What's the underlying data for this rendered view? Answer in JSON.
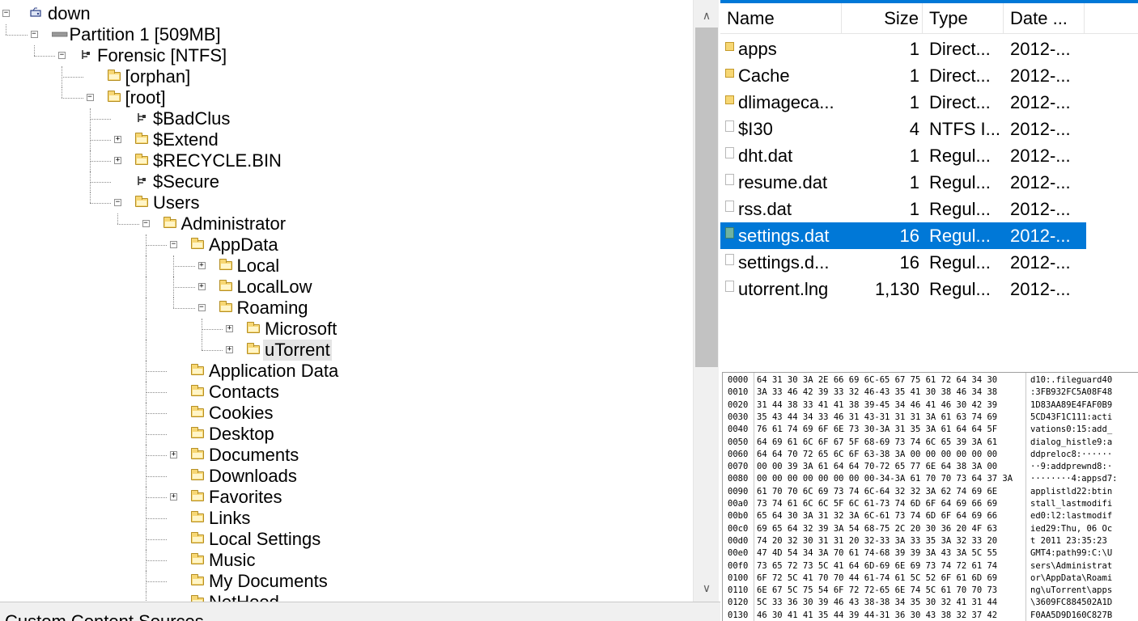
{
  "tree": {
    "rows": [
      {
        "label": "down",
        "icon": "drive-icon"
      },
      {
        "label": "Partition 1 [509MB]",
        "icon": "partition-icon"
      },
      {
        "label": "Forensic [NTFS]",
        "icon": "filesystem-icon"
      },
      {
        "label": "[orphan]",
        "icon": "folder-icon"
      },
      {
        "label": "[root]",
        "icon": "folder-icon"
      },
      {
        "label": "$BadClus",
        "icon": "system-file-icon"
      },
      {
        "label": "$Extend",
        "icon": "folder-icon"
      },
      {
        "label": "$RECYCLE.BIN",
        "icon": "folder-icon"
      },
      {
        "label": "$Secure",
        "icon": "system-file-icon"
      },
      {
        "label": "Users",
        "icon": "folder-icon"
      },
      {
        "label": "Administrator",
        "icon": "folder-icon"
      },
      {
        "label": "AppData",
        "icon": "folder-icon"
      },
      {
        "label": "Local",
        "icon": "folder-icon"
      },
      {
        "label": "LocalLow",
        "icon": "folder-icon"
      },
      {
        "label": "Roaming",
        "icon": "folder-icon"
      },
      {
        "label": "Microsoft",
        "icon": "folder-icon"
      },
      {
        "label": "uTorrent",
        "icon": "folder-icon"
      },
      {
        "label": "Application Data",
        "icon": "folder-icon"
      },
      {
        "label": "Contacts",
        "icon": "folder-icon"
      },
      {
        "label": "Cookies",
        "icon": "folder-icon"
      },
      {
        "label": "Desktop",
        "icon": "folder-icon"
      },
      {
        "label": "Documents",
        "icon": "folder-icon"
      },
      {
        "label": "Downloads",
        "icon": "folder-icon"
      },
      {
        "label": "Favorites",
        "icon": "folder-icon"
      },
      {
        "label": "Links",
        "icon": "folder-icon"
      },
      {
        "label": "Local Settings",
        "icon": "folder-icon"
      },
      {
        "label": "Music",
        "icon": "folder-icon"
      },
      {
        "label": "My Documents",
        "icon": "folder-icon"
      },
      {
        "label": "NetHood",
        "icon": "folder-icon"
      }
    ]
  },
  "scrollbar": {
    "up_icon": "up-arrow-icon",
    "down_icon": "down-arrow-icon"
  },
  "status_bar": {
    "text": "Custom Content Sources"
  },
  "file_list": {
    "columns": {
      "name": "Name",
      "size": "Size",
      "type": "Type",
      "date": "Date ..."
    },
    "rows": [
      {
        "name": "apps",
        "size": "1",
        "type": "Direct...",
        "date": "2012-...",
        "icon": "folder-icon"
      },
      {
        "name": "Cache",
        "size": "1",
        "type": "Direct...",
        "date": "2012-...",
        "icon": "folder-icon"
      },
      {
        "name": "dlimageca...",
        "size": "1",
        "type": "Direct...",
        "date": "2012-...",
        "icon": "folder-icon"
      },
      {
        "name": "$I30",
        "size": "4",
        "type": "NTFS I...",
        "date": "2012-...",
        "icon": "file-icon"
      },
      {
        "name": "dht.dat",
        "size": "1",
        "type": "Regul...",
        "date": "2012-...",
        "icon": "file-icon"
      },
      {
        "name": "resume.dat",
        "size": "1",
        "type": "Regul...",
        "date": "2012-...",
        "icon": "file-icon"
      },
      {
        "name": "rss.dat",
        "size": "1",
        "type": "Regul...",
        "date": "2012-...",
        "icon": "file-icon"
      },
      {
        "name": "settings.dat",
        "size": "16",
        "type": "Regul...",
        "date": "2012-...",
        "icon": "file-icon",
        "selected": true
      },
      {
        "name": "settings.d...",
        "size": "16",
        "type": "Regul...",
        "date": "2012-...",
        "icon": "file-icon"
      },
      {
        "name": "utorrent.lng",
        "size": "1,130",
        "type": "Regul...",
        "date": "2012-...",
        "icon": "file-icon"
      }
    ]
  },
  "hex": {
    "rows": [
      {
        "offset": "0000",
        "bytes": "64 31 30 3A 2E 66 69 6C-65 67 75 61 72 64 34 30",
        "ascii": "d10:.fileguard40"
      },
      {
        "offset": "0010",
        "bytes": "3A 33 46 42 39 33 32 46-43 35 41 30 38 46 34 38",
        "ascii": ":3FB932FC5A08F48"
      },
      {
        "offset": "0020",
        "bytes": "31 44 38 33 41 41 38 39-45 34 46 41 46 30 42 39",
        "ascii": "1D83AA89E4FAF0B9"
      },
      {
        "offset": "0030",
        "bytes": "35 43 44 34 33 46 31 43-31 31 31 3A 61 63 74 69",
        "ascii": "5CD43F1C111:acti"
      },
      {
        "offset": "0040",
        "bytes": "76 61 74 69 6F 6E 73 30-3A 31 35 3A 61 64 64 5F",
        "ascii": "vations0:15:add_"
      },
      {
        "offset": "0050",
        "bytes": "64 69 61 6C 6F 67 5F 68-69 73 74 6C 65 39 3A 61",
        "ascii": "dialog_histle9:a"
      },
      {
        "offset": "0060",
        "bytes": "64 64 70 72 65 6C 6F 63-38 3A 00 00 00 00 00 00",
        "ascii": "ddpreloc8:······"
      },
      {
        "offset": "0070",
        "bytes": "00 00 39 3A 61 64 64 70-72 65 77 6E 64 38 3A 00",
        "ascii": "··9:addprewnd8:·"
      },
      {
        "offset": "0080",
        "bytes": "00 00 00 00 00 00 00 00-34-3A 61 70 70 73 64 37 3A",
        "ascii": "········4:appsd7:"
      },
      {
        "offset": "0090",
        "bytes": "61 70 70 6C 69 73 74 6C-64 32 32 3A 62 74 69 6E",
        "ascii": "applistld22:btin"
      },
      {
        "offset": "00a0",
        "bytes": "73 74 61 6C 6C 5F 6C 61-73 74 6D 6F 64 69 66 69",
        "ascii": "stall_lastmodifi"
      },
      {
        "offset": "00b0",
        "bytes": "65 64 30 3A 31 32 3A 6C-61 73 74 6D 6F 64 69 66",
        "ascii": "ed0:l2:lastmodif"
      },
      {
        "offset": "00c0",
        "bytes": "69 65 64 32 39 3A 54 68-75 2C 20 30 36 20 4F 63",
        "ascii": "ied29:Thu, 06 Oc"
      },
      {
        "offset": "00d0",
        "bytes": "74 20 32 30 31 31 20 32-33 3A 33 35 3A 32 33 20",
        "ascii": "t 2011 23:35:23 "
      },
      {
        "offset": "00e0",
        "bytes": "47 4D 54 34 3A 70 61 74-68 39 39 3A 43 3A 5C 55",
        "ascii": "GMT4:path99:C:\\U"
      },
      {
        "offset": "00f0",
        "bytes": "73 65 72 73 5C 41 64 6D-69 6E 69 73 74 72 61 74",
        "ascii": "sers\\Administrat"
      },
      {
        "offset": "0100",
        "bytes": "6F 72 5C 41 70 70 44 61-74 61 5C 52 6F 61 6D 69",
        "ascii": "or\\AppData\\Roami"
      },
      {
        "offset": "0110",
        "bytes": "6E 67 5C 75 54 6F 72 72-65 6E 74 5C 61 70 70 73",
        "ascii": "ng\\uTorrent\\apps"
      },
      {
        "offset": "0120",
        "bytes": "5C 33 36 30 39 46 43 38-38 34 35 30 32 41 31 44",
        "ascii": "\\3609FC884502A1D"
      },
      {
        "offset": "0130",
        "bytes": "46 30 41 41 35 44 39 44-31 36 30 43 38 32 37 42",
        "ascii": "F0AA5D9D160C827B"
      }
    ]
  }
}
